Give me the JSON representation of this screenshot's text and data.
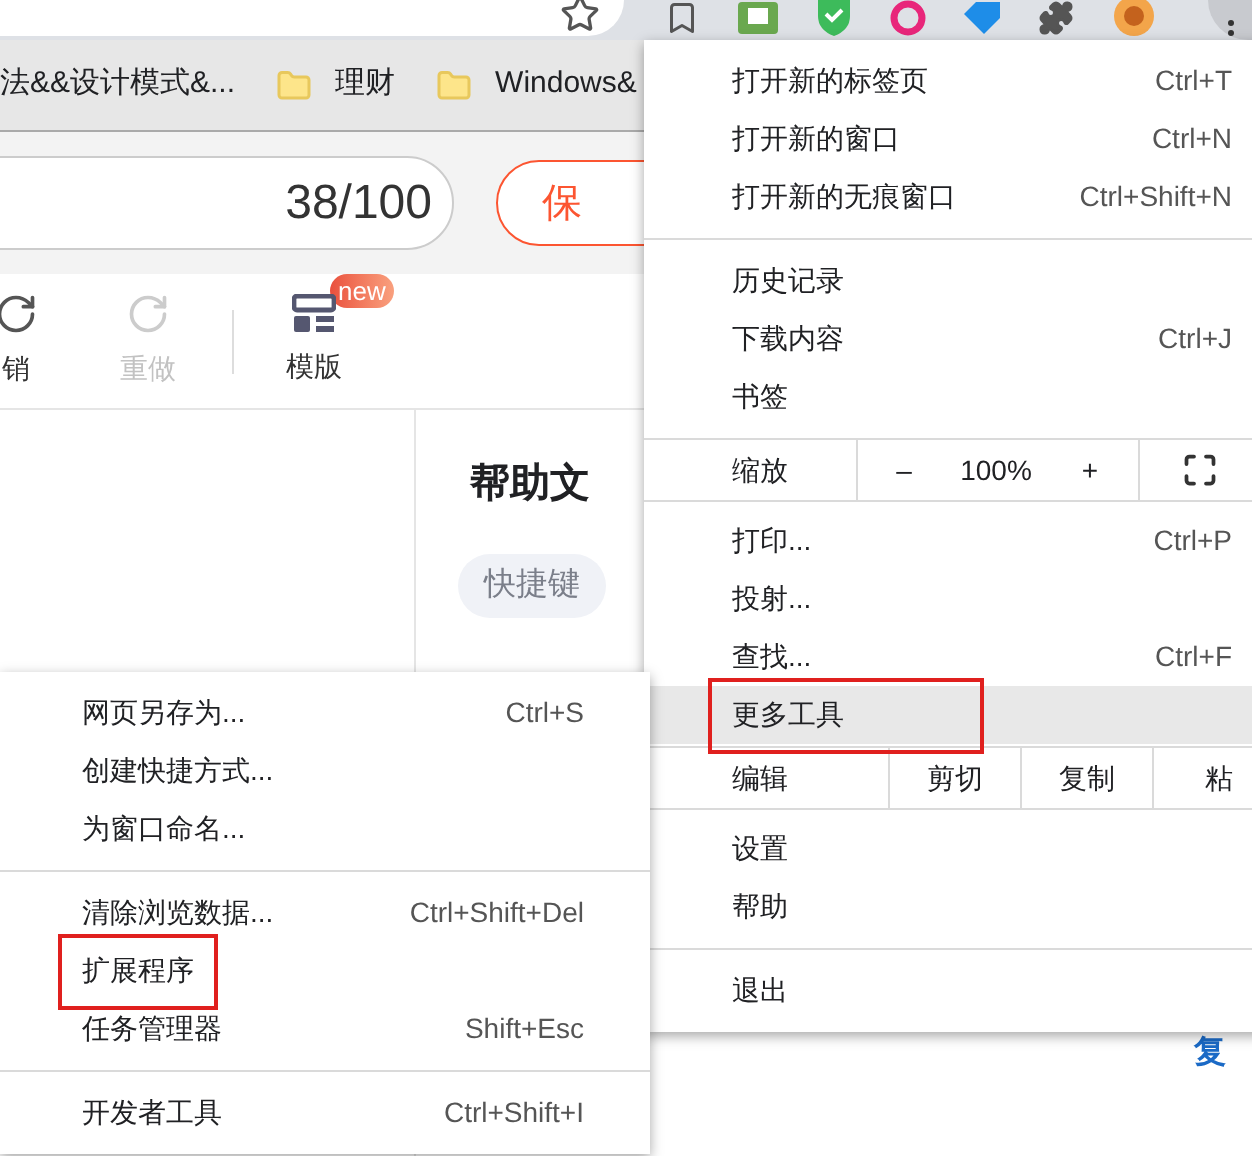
{
  "bookmarks": [
    {
      "kind": "text",
      "label": "法&&设计模式&..."
    },
    {
      "kind": "folder",
      "label": "理财"
    },
    {
      "kind": "folder",
      "label": "Windows&"
    }
  ],
  "editor": {
    "counter": "38/100",
    "save_button": "保"
  },
  "tools": [
    {
      "kind": "undo",
      "label": "销",
      "disabled": false
    },
    {
      "kind": "redo",
      "label": "重做",
      "disabled": true
    },
    {
      "kind": "template",
      "label": "模版",
      "disabled": false,
      "badge": "new"
    }
  ],
  "help_panel": {
    "title": "帮助文",
    "tags": [
      "快捷键"
    ]
  },
  "copy_link": "复",
  "main_menu": [
    {
      "kind": "item",
      "label": "打开新的标签页",
      "shortcut": "Ctrl+T",
      "selected": false,
      "boxed": false
    },
    {
      "kind": "item",
      "label": "打开新的窗口",
      "shortcut": "Ctrl+N",
      "selected": false,
      "boxed": false
    },
    {
      "kind": "item",
      "label": "打开新的无痕窗口",
      "shortcut": "Ctrl+Shift+N",
      "selected": false,
      "boxed": false
    },
    {
      "kind": "separator"
    },
    {
      "kind": "item",
      "label": "历史记录",
      "selected": false,
      "boxed": false
    },
    {
      "kind": "item",
      "label": "下载内容",
      "shortcut": "Ctrl+J",
      "selected": false,
      "boxed": false
    },
    {
      "kind": "item",
      "label": "书签",
      "selected": false,
      "boxed": false
    },
    {
      "kind": "zoom",
      "label": "缩放",
      "minus": "–",
      "value": "100%",
      "plus": "+"
    },
    {
      "kind": "item",
      "label": "打印...",
      "shortcut": "Ctrl+P",
      "selected": false,
      "boxed": false
    },
    {
      "kind": "item",
      "label": "投射...",
      "selected": false,
      "boxed": false
    },
    {
      "kind": "item",
      "label": "查找...",
      "shortcut": "Ctrl+F",
      "selected": false,
      "boxed": false
    },
    {
      "kind": "item",
      "label": "更多工具",
      "selected": true,
      "boxed": true
    },
    {
      "kind": "edit",
      "label": "编辑",
      "actions": [
        "剪切",
        "复制",
        "粘"
      ]
    },
    {
      "kind": "item",
      "label": "设置",
      "selected": false,
      "boxed": false
    },
    {
      "kind": "item",
      "label": "帮助",
      "selected": false,
      "boxed": false
    },
    {
      "kind": "separator"
    },
    {
      "kind": "item",
      "label": "退出",
      "selected": false,
      "boxed": false
    }
  ],
  "sub_menu": [
    {
      "kind": "item",
      "label": "网页另存为...",
      "shortcut": "Ctrl+S",
      "selected": false,
      "boxed": false
    },
    {
      "kind": "item",
      "label": "创建快捷方式...",
      "selected": false,
      "boxed": false
    },
    {
      "kind": "item",
      "label": "为窗口命名...",
      "selected": false,
      "boxed": false
    },
    {
      "kind": "separator"
    },
    {
      "kind": "item",
      "label": "清除浏览数据...",
      "shortcut": "Ctrl+Shift+Del",
      "selected": false,
      "boxed": false
    },
    {
      "kind": "item",
      "label": "扩展程序",
      "selected": false,
      "boxed": true
    },
    {
      "kind": "item",
      "label": "任务管理器",
      "shortcut": "Shift+Esc",
      "selected": false,
      "boxed": false
    },
    {
      "kind": "separator"
    },
    {
      "kind": "item",
      "label": "开发者工具",
      "shortcut": "Ctrl+Shift+I",
      "selected": false,
      "boxed": false
    }
  ]
}
